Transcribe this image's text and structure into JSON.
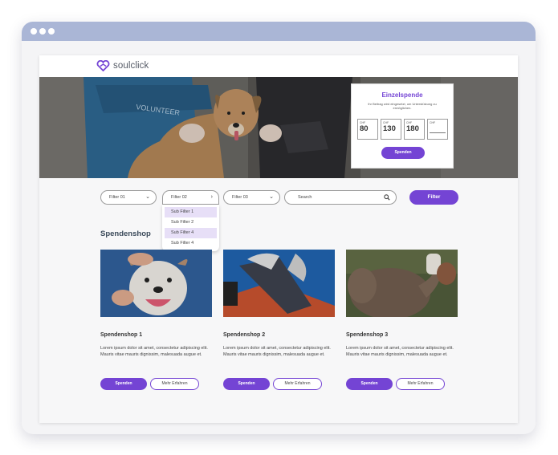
{
  "brand": {
    "name": "soulclick",
    "accent": "#7444d4"
  },
  "donation": {
    "title": "Einzelspende",
    "subtitle": "Ihr Beitrag wird eingesetzt, um Unterstützung zu ermöglichen.",
    "currency": "CHF",
    "amounts": [
      "80",
      "130",
      "180",
      ""
    ],
    "button": "Spenden"
  },
  "filters": [
    {
      "label": "Filter 01",
      "icon": "chevron-down-icon"
    },
    {
      "label": "Filter 02",
      "icon": "chevron-right-icon"
    },
    {
      "label": "Filter 03",
      "icon": "chevron-down-icon"
    }
  ],
  "search": {
    "placeholder": "Search",
    "icon": "search-icon"
  },
  "filter_button": "Filter",
  "dropdown": {
    "items": [
      "Sub Filter 1",
      "Sub Filter 2",
      "Sub Filter 4",
      "Sub Filter 4"
    ],
    "highlighted": [
      0,
      2
    ]
  },
  "section_title": "Spendenshop",
  "cards": [
    {
      "title": "Spendenshop 1",
      "text": "Lorem ipsum dolor sit amet, consectetur adipiscing elit. Mauris vitae mauris dignissim, malesuada augue et.",
      "primary": "Spenden",
      "secondary": "Mehr Erfahren"
    },
    {
      "title": "Spendenshop 2",
      "text": "Lorem ipsum dolor sit amet, consectetur adipiscing elit. Mauris vitae mauris dignissim, malesuada augue et.",
      "primary": "Spenden",
      "secondary": "Mehr Erfahren"
    },
    {
      "title": "Spendenshop 3",
      "text": "Lorem ipsum dolor sit amet, consectetur adipiscing elit. Mauris vitae mauris dignissim, malesuada augue et.",
      "primary": "Spenden",
      "secondary": "Mehr Erfahren"
    }
  ]
}
